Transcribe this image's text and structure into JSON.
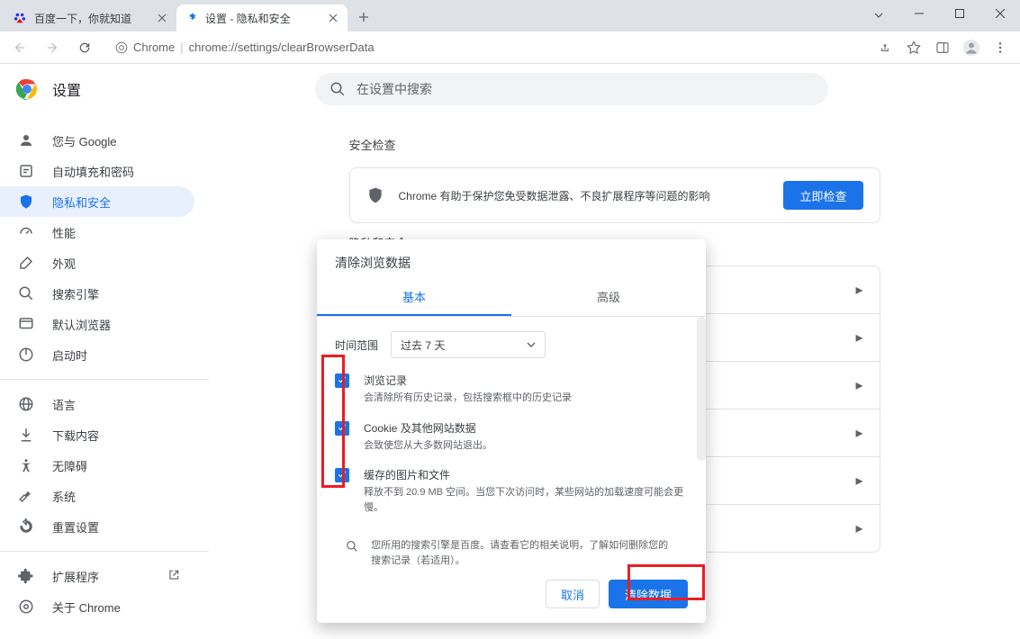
{
  "window": {
    "tabs": [
      {
        "title": "百度一下，你就知道",
        "favicon": "baidu"
      },
      {
        "title": "设置 - 隐私和安全",
        "favicon": "gear"
      }
    ]
  },
  "omnibox": {
    "vendor": "Chrome",
    "url": "chrome://settings/clearBrowserData"
  },
  "settings": {
    "title": "设置",
    "search_placeholder": "在设置中搜索"
  },
  "sidebar": {
    "items": [
      {
        "icon": "person",
        "label": "您与 Google"
      },
      {
        "icon": "autofill",
        "label": "自动填充和密码"
      },
      {
        "icon": "shield",
        "label": "隐私和安全",
        "active": true
      },
      {
        "icon": "speed",
        "label": "性能"
      },
      {
        "icon": "appearance",
        "label": "外观"
      },
      {
        "icon": "search",
        "label": "搜索引擎"
      },
      {
        "icon": "browser",
        "label": "默认浏览器"
      },
      {
        "icon": "power",
        "label": "启动时"
      }
    ],
    "secondary": [
      {
        "icon": "globe",
        "label": "语言"
      },
      {
        "icon": "download",
        "label": "下载内容"
      },
      {
        "icon": "accessibility",
        "label": "无障碍"
      },
      {
        "icon": "wrench",
        "label": "系统"
      },
      {
        "icon": "reset",
        "label": "重置设置"
      }
    ],
    "tertiary": [
      {
        "icon": "extension",
        "label": "扩展程序",
        "external": true
      },
      {
        "icon": "chrome",
        "label": "关于 Chrome"
      }
    ]
  },
  "main": {
    "section1_title": "安全检查",
    "safety_text": "Chrome 有助于保护您免受数据泄露、不良扩展程序等问题的影响",
    "safety_button": "立即检查",
    "section2_title": "隐私和安全"
  },
  "dialog": {
    "title": "清除浏览数据",
    "tabs": {
      "basic": "基本",
      "advanced": "高级"
    },
    "time_label": "时间范围",
    "time_value": "过去 7 天",
    "options": [
      {
        "title": "浏览记录",
        "desc": "会清除所有历史记录，包括搜索框中的历史记录"
      },
      {
        "title": "Cookie 及其他网站数据",
        "desc": "会致使您从大多数网站退出。"
      },
      {
        "title": "缓存的图片和文件",
        "desc": "释放不到 20.9 MB 空间。当您下次访问时，某些网站的加载速度可能会更慢。"
      }
    ],
    "info": "您所用的搜索引擎是百度。请查看它的相关说明，了解如何删除您的搜索记录（若适用）。",
    "cancel": "取消",
    "confirm": "清除数据"
  }
}
